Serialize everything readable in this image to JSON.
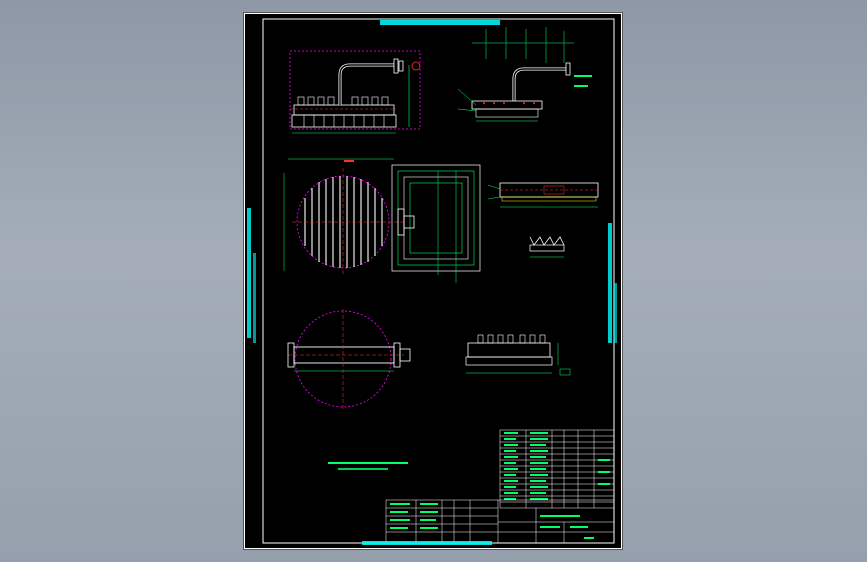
{
  "drawing": {
    "background": "#000000",
    "frame_color": "#ffffff",
    "geometry_color": "#ffffff",
    "dimension_color": "#00ff66",
    "centerline_color": "#ff00ff",
    "hatch_color": "#ffff00",
    "accent_red": "#ff3030",
    "accent_cyan": "#00ffff"
  },
  "views": [
    "front-elevation",
    "side-elevation",
    "plan-view",
    "section-view",
    "detail-a",
    "detail-b",
    "bottom-front-view"
  ],
  "title_block": {
    "rows": 5,
    "parts_list_rows": 12
  }
}
